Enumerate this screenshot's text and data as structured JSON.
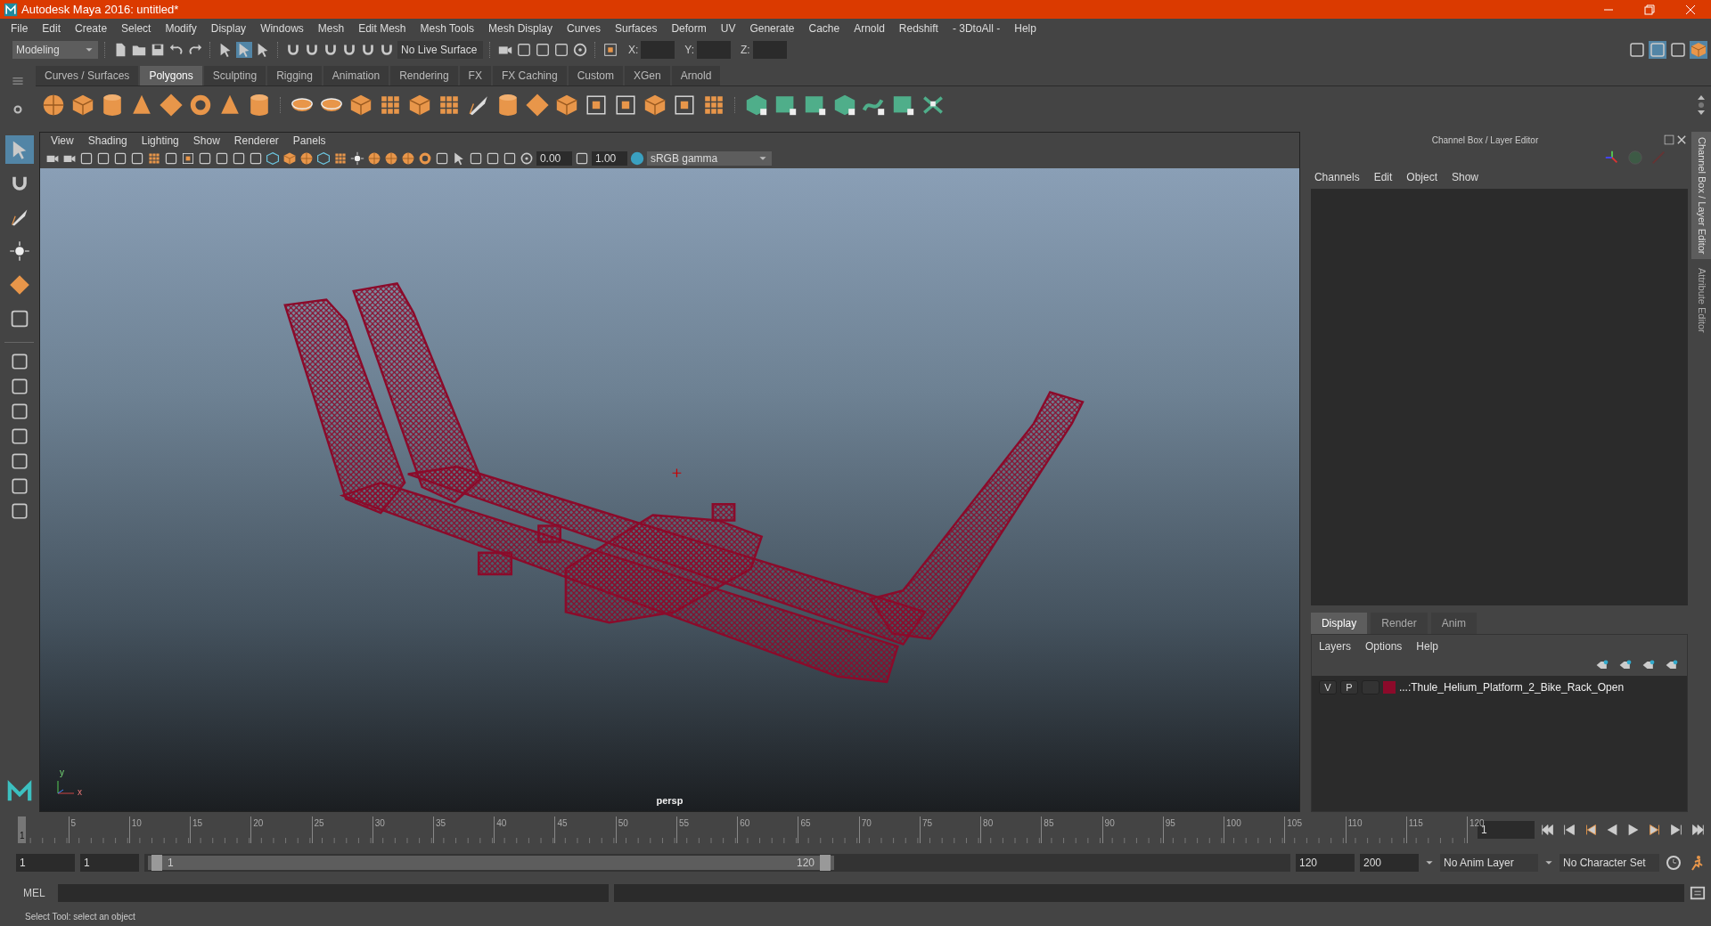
{
  "window": {
    "title": "Autodesk Maya 2016: untitled*"
  },
  "menu_bar": [
    "File",
    "Edit",
    "Create",
    "Select",
    "Modify",
    "Display",
    "Windows",
    "Mesh",
    "Edit Mesh",
    "Mesh Tools",
    "Mesh Display",
    "Curves",
    "Surfaces",
    "Deform",
    "UV",
    "Generate",
    "Cache",
    "Arnold",
    "Redshift",
    "- 3DtoAll -",
    "Help"
  ],
  "status_line": {
    "mode": "Modeling",
    "live_surface": "No Live Surface",
    "x_label": "X:",
    "y_label": "Y:",
    "z_label": "Z:"
  },
  "shelf_tabs": [
    {
      "label": "Curves / Surfaces",
      "selected": false
    },
    {
      "label": "Polygons",
      "selected": true
    },
    {
      "label": "Sculpting",
      "selected": false
    },
    {
      "label": "Rigging",
      "selected": false
    },
    {
      "label": "Animation",
      "selected": false
    },
    {
      "label": "Rendering",
      "selected": false
    },
    {
      "label": "FX",
      "selected": false
    },
    {
      "label": "FX Caching",
      "selected": false
    },
    {
      "label": "Custom",
      "selected": false
    },
    {
      "label": "XGen",
      "selected": false
    },
    {
      "label": "Arnold",
      "selected": false
    }
  ],
  "viewport": {
    "menu": [
      "View",
      "Shading",
      "Lighting",
      "Show",
      "Renderer",
      "Panels"
    ],
    "exposure": "0.00",
    "gamma": "1.00",
    "color_space": "sRGB gamma",
    "camera": "persp",
    "axis_labels": [
      "y",
      "x"
    ]
  },
  "channel_box": {
    "title": "Channel Box / Layer Editor",
    "menu": [
      "Channels",
      "Edit",
      "Object",
      "Show"
    ]
  },
  "layer_editor": {
    "tabs": [
      {
        "label": "Display",
        "selected": true
      },
      {
        "label": "Render",
        "selected": false
      },
      {
        "label": "Anim",
        "selected": false
      }
    ],
    "menu": [
      "Layers",
      "Options",
      "Help"
    ],
    "layers": [
      {
        "visible_label": "V",
        "playback_label": "P",
        "color": "#8b0a2a",
        "name": "...:Thule_Helium_Platform_2_Bike_Rack_Open"
      }
    ]
  },
  "side_tabs": [
    "Channel Box / Layer Editor",
    "Attribute Editor"
  ],
  "timeline": {
    "ticks": [
      "5",
      "10",
      "15",
      "20",
      "25",
      "30",
      "35",
      "40",
      "45",
      "50",
      "55",
      "60",
      "65",
      "70",
      "75",
      "80",
      "85",
      "90",
      "95",
      "100",
      "105",
      "110",
      "115",
      "120"
    ],
    "current_frame_marker": "1",
    "current_frame_field": "1"
  },
  "range": {
    "start": "1",
    "playback_start": "1",
    "slider_start": "1",
    "slider_end": "120",
    "playback_end": "120",
    "end": "200",
    "anim_layer": "No Anim Layer",
    "character_set": "No Character Set"
  },
  "command_line": {
    "label": "MEL"
  },
  "help_line": "Select Tool: select an object"
}
